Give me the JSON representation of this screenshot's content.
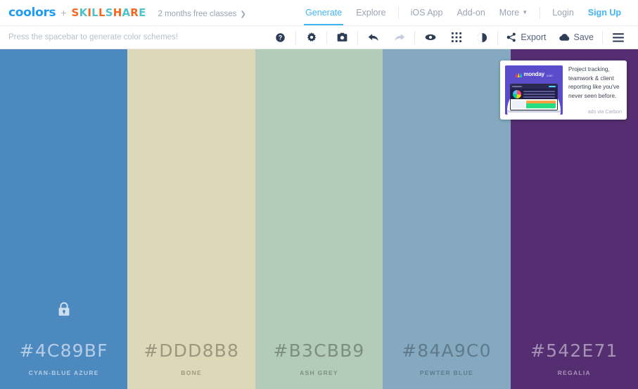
{
  "header": {
    "logo": "coolors",
    "plus": "+",
    "partner_logo": "SKILLSHARE",
    "promo_text": "2 months free classes",
    "promo_chevron": "❯",
    "nav": [
      {
        "label": "Generate",
        "active": true
      },
      {
        "label": "Explore",
        "active": false
      },
      {
        "label": "iOS App",
        "active": false
      },
      {
        "label": "Add-on",
        "active": false
      },
      {
        "label": "More",
        "active": false,
        "caret": "▼"
      },
      {
        "label": "Login",
        "active": false
      },
      {
        "label": "Sign Up",
        "active": false
      }
    ]
  },
  "toolbar": {
    "hint": "Press the spacebar to generate color schemes!",
    "icons": [
      {
        "name": "help-icon"
      },
      {
        "name": "adjust-icon"
      },
      {
        "name": "camera-icon"
      },
      {
        "name": "undo-icon"
      },
      {
        "name": "redo-icon"
      },
      {
        "name": "view-icon"
      },
      {
        "name": "grid-icon"
      },
      {
        "name": "contrast-icon"
      }
    ],
    "export_label": "Export",
    "save_label": "Save",
    "menu_label": "menu"
  },
  "palette": {
    "swatches": [
      {
        "hex": "#4C89BF",
        "name": "CYAN-BLUE AZURE",
        "locked": true,
        "text": "rgba(255,255,255,0.58)"
      },
      {
        "hex": "#DDD8B8",
        "name": "BONE",
        "locked": false,
        "text": "rgba(0,0,0,0.30)"
      },
      {
        "hex": "#B3CBB9",
        "name": "ASH GREY",
        "locked": false,
        "text": "rgba(0,0,0,0.30)"
      },
      {
        "hex": "#84A9C0",
        "name": "PEWTER BLUE",
        "locked": false,
        "text": "rgba(0,0,0,0.28)"
      },
      {
        "hex": "#542E71",
        "name": "REGALIA",
        "locked": false,
        "text": "rgba(255,255,255,0.48)"
      }
    ]
  },
  "ad": {
    "brand": "monday",
    "brand_tld": ".com",
    "text": "Project tracking, teamwork & client reporting like you've never seen before.",
    "attribution": "ads via Carbon"
  },
  "colors": {
    "accent": "#41b6f6",
    "logo_blue": "#1d9bf5",
    "partner_orange": "#f4671f",
    "partner_teal": "#4ec3c9",
    "toolbar_icon": "#2e3d57",
    "muted_text": "#9aa4b4"
  }
}
